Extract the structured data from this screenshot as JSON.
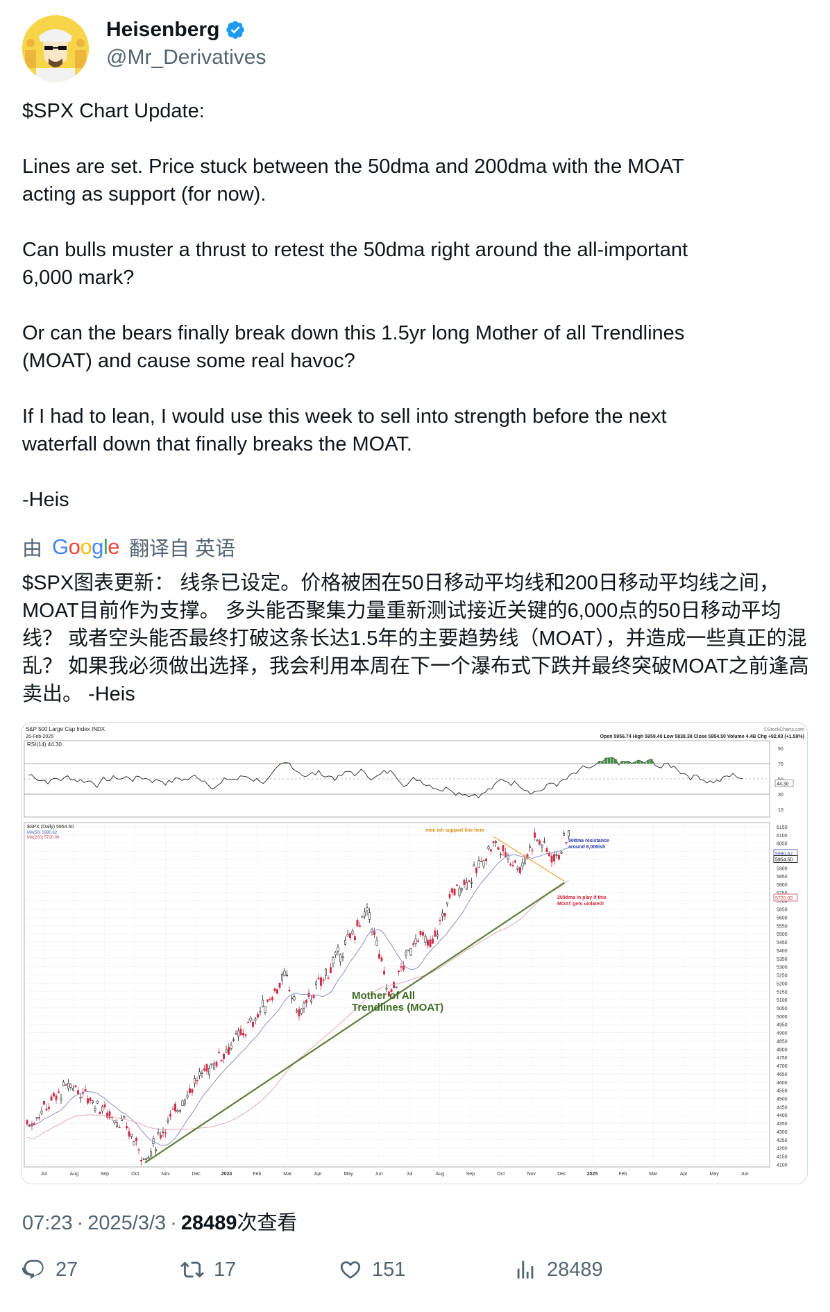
{
  "author": {
    "name": "Heisenberg",
    "handle": "@Mr_Derivatives",
    "verified": true
  },
  "tweet": {
    "paragraphs": [
      "$SPX Chart Update:",
      "Lines are set. Price stuck between the 50dma and 200dma with the MOAT\nacting as support (for now).",
      "Can bulls muster a thrust to retest the 50dma right around the all-important\n6,000 mark?",
      "Or can the bears finally break down this 1.5yr long Mother of all Trendlines\n(MOAT) and cause some real havoc?",
      "If I had to lean, I would use this week to sell into strength before the next\nwaterfall down that finally breaks the MOAT.",
      "-Heis"
    ]
  },
  "translation": {
    "prefix": "由",
    "provider": "Google",
    "suffix": "翻译自 英语",
    "text": "$SPX图表更新： 线条已设定。价格被困在50日移动平均线和200日移动平均线之间，MOAT目前作为支撑。 多头能否聚集力量重新测试接近关键的6,000点的50日移动平均线？ 或者空头能否最终打破这条长达1.5年的主要趋势线（MOAT），并造成一些真正的混乱？ 如果我必须做出选择，我会利用本周在下一个瀑布式下跌并最终突破MOAT之前逢高卖出。 -Heis"
  },
  "chart_image": {
    "title": "S&P 500 Large Cap Index INDX",
    "date": "26-Feb-2025",
    "source": "©StockCharts.com",
    "ohlc": "Open 5956.74  High 5959.40  Low 5838.38  Close 5954.50  Volume 4.4B  Chg +92.93 (+1.59%)",
    "rsi_label": "RSI(14) 44.30",
    "rsi_current": "44.30",
    "price_label": "$SPX (Daily) 5954.50",
    "ma50_label": "MA(50) 5990.62",
    "ma200_label": "MA(200) 5720.09",
    "badge_ma50": "5990.62",
    "badge_price": "5954.50",
    "badge_ma200": "5720.09",
    "annotation_support": "mini ish support line here",
    "annotation_50dma": "50dma resistance\naround 6,000ish",
    "annotation_200dma": "200dma in play if this\nMOAT gets violated!",
    "annotation_moat": "Mother of All\nTrendlines (MOAT)",
    "rsi_ticks": [
      "90",
      "70",
      "50",
      "30",
      "10"
    ],
    "price_ticks": [
      "6150",
      "6100",
      "6050",
      "6000",
      "5950",
      "5900",
      "5850",
      "5800",
      "5750",
      "5700",
      "5650",
      "5600",
      "5550",
      "5500",
      "5450",
      "5400",
      "5350",
      "5300",
      "5250",
      "5200",
      "5150",
      "5100",
      "5050",
      "5000",
      "4950",
      "4900",
      "4850",
      "4800",
      "4750",
      "4700",
      "4650",
      "4600",
      "4550",
      "4500",
      "4450",
      "4400",
      "4350",
      "4300",
      "4250",
      "4200",
      "4150",
      "4100"
    ],
    "x_labels": [
      "Jul",
      "Aug",
      "Sep",
      "Oct",
      "Nov",
      "Dec",
      "2024",
      "Feb",
      "Mar",
      "Apr",
      "May",
      "Jun",
      "Jul",
      "Aug",
      "Sep",
      "Oct",
      "Nov",
      "Dec",
      "2025",
      "Feb",
      "Mar",
      "Apr",
      "May",
      "Jun"
    ],
    "colors": {
      "moat": "#5a7f3a",
      "support": "#f0a030",
      "ma50": "#8a90c8",
      "ma200": "#e8a8b0",
      "up": "#222222",
      "down": "#d0304a",
      "rsi_fill": "#4a8a4a"
    }
  },
  "meta": {
    "time": "07:23",
    "date": "2025/3/3",
    "views_num": "28489",
    "views_label": "次查看"
  },
  "actions": {
    "replies": "27",
    "reposts": "17",
    "likes": "151",
    "views": "28489"
  }
}
